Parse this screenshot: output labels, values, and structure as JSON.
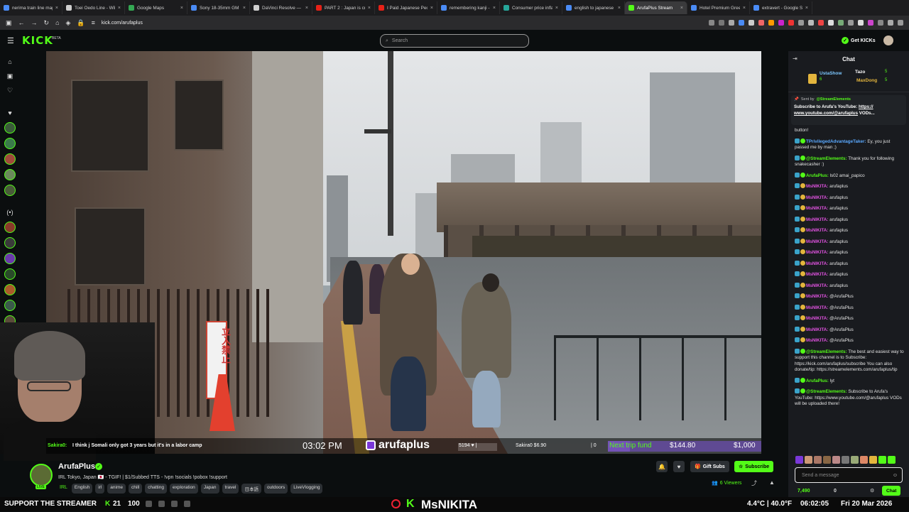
{
  "browser": {
    "tabs": [
      {
        "label": "nerima train line map",
        "color": "#4a8bf5"
      },
      {
        "label": "Toei Ōedo Line - Wiki",
        "color": "#cfcfcf"
      },
      {
        "label": "Google Maps",
        "color": "#34a853"
      },
      {
        "label": "Sony 18-35mm GM L",
        "color": "#4a8bf5"
      },
      {
        "label": "DaVinci Resolve — M",
        "color": "#cfcfcf"
      },
      {
        "label": "PART 2 : Japan is curr",
        "color": "#e62117"
      },
      {
        "label": "I Paid Japanese Peopl",
        "color": "#e62117"
      },
      {
        "label": "remembering kanji - (",
        "color": "#4a8bf5"
      },
      {
        "label": "Consumer price inflati",
        "color": "#26a69a"
      },
      {
        "label": "english to japanese -",
        "color": "#4a8bf5"
      },
      {
        "label": "ArufaPlus Stream",
        "color": "#53fc18",
        "active": true
      },
      {
        "label": "Hotel Premium Green",
        "color": "#4a8bf5"
      },
      {
        "label": "extravert - Google Se",
        "color": "#4a8bf5"
      }
    ],
    "url": "kick.com/arufaplus"
  },
  "site": {
    "logo": "KICK",
    "logo_badge": "BETA",
    "search_placeholder": "Search",
    "get_kicks": "Get KICKs"
  },
  "overlay": {
    "chat_user": "Sakira0:",
    "chat_msg": "I think j Somali only got 3 years but it's in a labor camp",
    "time": "03:02 PM",
    "channel": "arufaplus",
    "n1": "5194 ♥ |",
    "sakira": "Sakira0 $6.90",
    "zero": "| 0",
    "trip_label": "Next trip fund",
    "trip_raised": "$144.80",
    "trip_goal": "$1,000",
    "trip_progress": 0.1448,
    "stream_gauge": 0.55
  },
  "video": {
    "sign_text": "立入禁止"
  },
  "channel": {
    "name": "ArufaPlus",
    "live": "LIVE",
    "title": "IRL Tokyo, Japan 🇯🇵 - TGIF! | $1/Subbed TTS - !vpn !socials !pobox !support",
    "category": "IRL",
    "tags": [
      "English",
      "irl",
      "anime",
      "chill",
      "chatting",
      "exploration",
      "Japan",
      "travel",
      "日本語",
      "outdoors",
      "LiveVlogging"
    ],
    "gift_subs": "Gift Subs",
    "subscribe": "Subscribe",
    "viewers": "6 Viewers"
  },
  "chat": {
    "header": "Chat",
    "leaderboard": [
      {
        "name": "UstaShow",
        "value": "6",
        "color": "#7cc7ff"
      },
      {
        "name": "Tazo",
        "value": "5",
        "color": "#ffffff"
      },
      {
        "name": "MaxDong",
        "value": "5",
        "color": "#e3b53d"
      }
    ],
    "pinned_by_label": "Sent by",
    "pinned_by": "@StreamElements",
    "pinned_text_pre": "Subscribe to Arufa's YouTube: ",
    "pinned_link": "https://",
    "pinned_link2": "www.youtube.com/@arufaplus",
    "pinned_text_post": " VODs...",
    "messages": [
      {
        "user": "",
        "text": "button!",
        "color": "#ffffff"
      },
      {
        "user": "TPrivilegedAdvantageTaker:",
        "text": "Ey, you just passed me by man ;)",
        "color": "#5aa9ff"
      },
      {
        "user": "@StreamElements:",
        "text": "Thank you for following snakecasher :)",
        "color": "#53fc18"
      },
      {
        "user": "ArufaPlus:",
        "text": "ls02 amai_papico",
        "color": "#53fc18"
      },
      {
        "user": "MsNIKITA:",
        "text": "arufaplus",
        "color": "#e052e0"
      },
      {
        "user": "MsNIKITA:",
        "text": "arufaplus",
        "color": "#e052e0"
      },
      {
        "user": "MsNIKITA:",
        "text": "arufaplus",
        "color": "#e052e0"
      },
      {
        "user": "MsNIKITA:",
        "text": "arufaplus",
        "color": "#e052e0"
      },
      {
        "user": "MsNIKITA:",
        "text": "arufaplus",
        "color": "#e052e0"
      },
      {
        "user": "MsNIKITA:",
        "text": "arufaplus",
        "color": "#e052e0"
      },
      {
        "user": "MsNIKITA:",
        "text": "arufaplus",
        "color": "#e052e0"
      },
      {
        "user": "MsNIKITA:",
        "text": "arufaplus",
        "color": "#e052e0"
      },
      {
        "user": "MsNIKITA:",
        "text": "arufaplus",
        "color": "#e052e0"
      },
      {
        "user": "MsNIKITA:",
        "text": "arufaplus",
        "color": "#e052e0"
      },
      {
        "user": "MsNIKITA:",
        "text": "@ArufaPlus",
        "color": "#e052e0"
      },
      {
        "user": "MsNIKITA:",
        "text": "@ArufaPlus",
        "color": "#e052e0"
      },
      {
        "user": "MsNIKITA:",
        "text": "@ArufaPlus",
        "color": "#e052e0"
      },
      {
        "user": "MsNIKITA:",
        "text": "@ArufaPlus",
        "color": "#e052e0"
      },
      {
        "user": "MsNIKITA:",
        "text": "@ArufaPlus",
        "color": "#e052e0"
      },
      {
        "user": "@StreamElements:",
        "text": "The best and easiest way to support this channel is to Subscribe: https://kick.com/arufaplus/subscribe You can also donate/tip: https://streamelements.com/arufaplus/tip",
        "color": "#53fc18"
      },
      {
        "user": "ArufaPlus:",
        "text": "lyt",
        "color": "#53fc18"
      },
      {
        "user": "@StreamElements:",
        "text": "Subscribe to Arufa's YouTube: https://www.youtube.com/@arufaplus VODs will be uploaded there!",
        "color": "#53fc18"
      }
    ],
    "input_placeholder": "Send a message",
    "kicks_count": "7,490",
    "zero_count": "0",
    "chat_button": "Chat"
  },
  "ticker": {
    "support": "SUPPORT THE STREAMER",
    "k_label": "K",
    "n1": "21",
    "n2": "100",
    "handle": "MsNIKITA",
    "weather": "4.4°C | 40.0°F",
    "clock": "06:02:05",
    "date": "Fri 20 Mar 2026"
  }
}
